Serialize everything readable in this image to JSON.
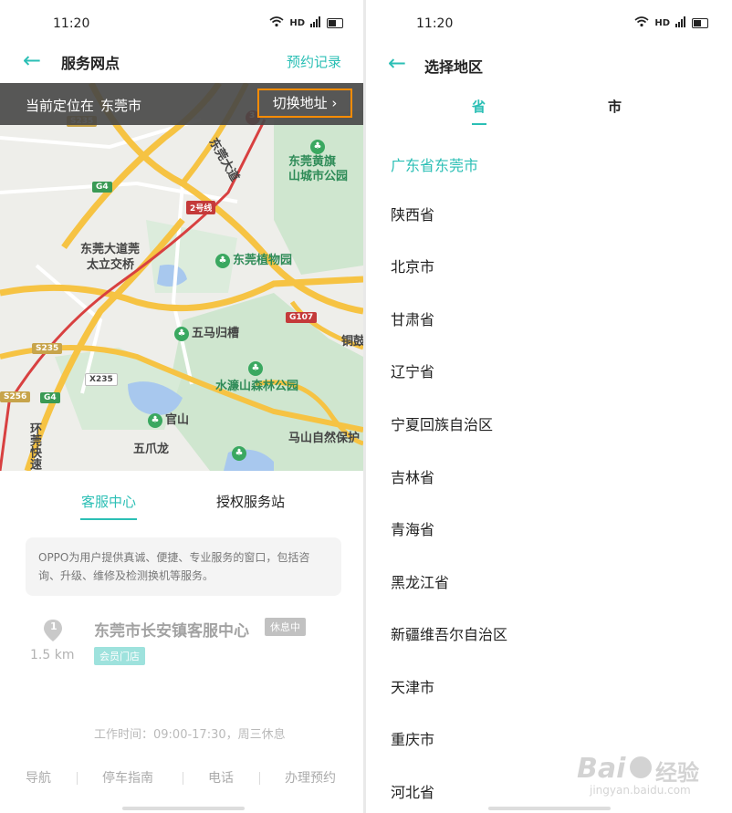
{
  "left": {
    "status": {
      "time": "11:20",
      "signal_text": "HD"
    },
    "header": {
      "title": "服务网点",
      "records_link": "预约记录"
    },
    "location": {
      "prefix": "当前定位在",
      "city": "东莞市",
      "switch_label": "切换地址 ›"
    },
    "map": {
      "pois": [
        {
          "name": "东莞黄旗山城市公园",
          "line1": "东莞黄旗",
          "line2": "山城市公园"
        },
        {
          "name": "东莞植物园"
        },
        {
          "name": "五马归槽"
        },
        {
          "name": "水濂山森林公园"
        },
        {
          "name": "官山"
        },
        {
          "name": "五爪龙"
        },
        {
          "name": "马山自然保护"
        },
        {
          "name": "东莞大道莞太立交桥",
          "line1": "东莞大道莞",
          "line2": "太立交桥"
        },
        {
          "name": "东莞大道"
        },
        {
          "name": "环莞快速"
        },
        {
          "name": "铜鼓"
        }
      ],
      "shields": [
        "2号线",
        "G107",
        "G4",
        "S235",
        "X235",
        "S256",
        "G4",
        "G4",
        "S235"
      ],
      "marker_number": "3",
      "marker_text": "东"
    },
    "tabs": [
      {
        "label": "客服中心",
        "active": true
      },
      {
        "label": "授权服务站",
        "active": false
      }
    ],
    "description": "OPPO为用户提供真诚、便捷、专业服务的窗口，包括咨询、升级、维修及检测换机等服务。",
    "store": {
      "index": "1",
      "distance": "1.5 km",
      "name": "东莞市长安镇客服中心",
      "status_badge": "休息中",
      "tag": "会员门店",
      "hours": "工作时间：09:00-17:30，周三休息"
    },
    "actions": [
      "导航",
      "停车指南",
      "电话",
      "办理预约"
    ]
  },
  "right": {
    "status": {
      "time": "11:20",
      "signal_text": "HD"
    },
    "header": {
      "title": "选择地区"
    },
    "tabs": [
      {
        "label": "省",
        "active": true
      },
      {
        "label": "市",
        "active": false
      }
    ],
    "current": "广东省东莞市",
    "provinces": [
      "陕西省",
      "北京市",
      "甘肃省",
      "辽宁省",
      "宁夏回族自治区",
      "吉林省",
      "青海省",
      "黑龙江省",
      "新疆维吾尔自治区",
      "天津市",
      "重庆市",
      "河北省"
    ]
  },
  "watermark": {
    "brand": "Bai",
    "brand2": "经验",
    "url": "jingyan.baidu.com"
  },
  "colors": {
    "accent": "#2bbfb5",
    "highlight_border": "#ff8c00",
    "road_yellow": "#f6c343",
    "road_red": "#d84040",
    "park_green": "#cfe6cf",
    "water": "#a8c8ee"
  }
}
